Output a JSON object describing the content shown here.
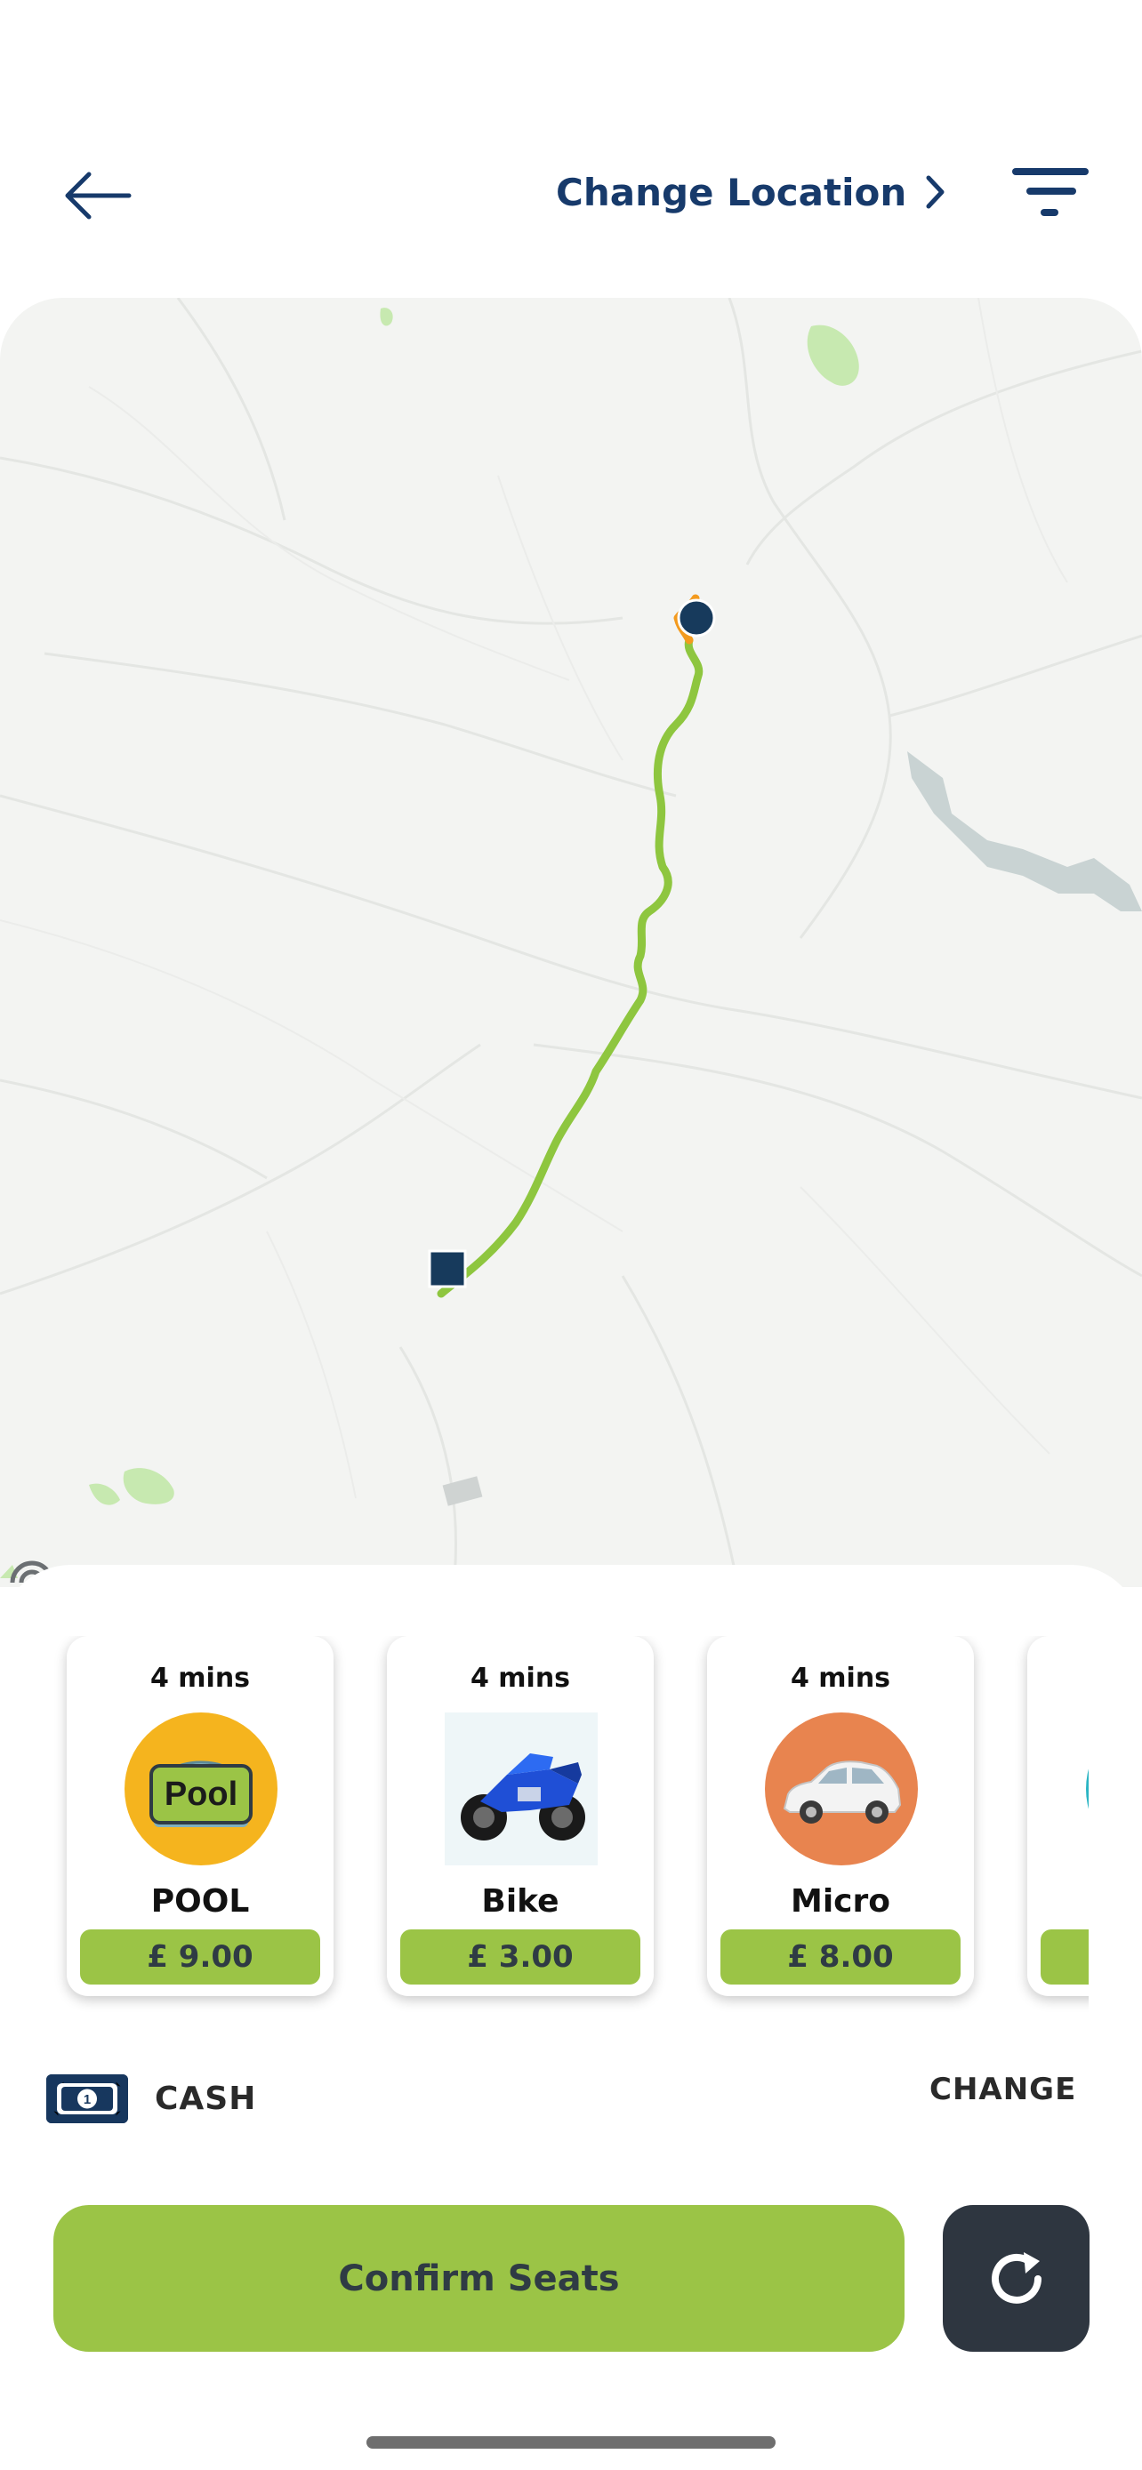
{
  "header": {
    "back_icon": "arrow-left-icon",
    "change_location_label": "Change Location",
    "change_location_icon": "chevron-right-icon",
    "filter_icon": "filter-icon"
  },
  "colors": {
    "navy": "#173a6b",
    "green": "#9bc446",
    "dark": "#2e3640",
    "route": "#8ec63f",
    "route_start": "#f39a1e",
    "pool_bg": "#f5b41e",
    "micro_bg": "#e8844f"
  },
  "vehicles": [
    {
      "eta": "4 mins",
      "name": "POOL",
      "price": "£ 9.00",
      "icon": "pool-car-icon",
      "badge": "Pool"
    },
    {
      "eta": "4 mins",
      "name": "Bike",
      "price": "£ 3.00",
      "icon": "motorbike-icon"
    },
    {
      "eta": "4 mins",
      "name": "Micro",
      "price": "£ 8.00",
      "icon": "car-icon"
    }
  ],
  "payment": {
    "method_icon": "cash-icon",
    "cash_icon_digit": "1",
    "method_label": "CASH",
    "change_label": "CHANGE"
  },
  "actions": {
    "confirm_label": "Confirm Seats",
    "refresh_icon": "refresh-icon"
  }
}
